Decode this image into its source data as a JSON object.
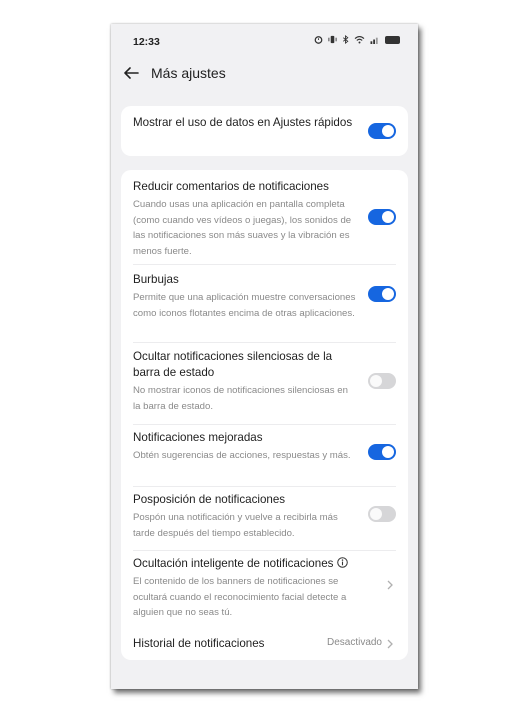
{
  "status_bar": {
    "time": "12:33",
    "icons": [
      "alarm-icon",
      "vibrate-icon",
      "bluetooth-icon",
      "wifi-icon",
      "signal-icon",
      "battery-icon"
    ]
  },
  "header": {
    "back_icon": "arrow-left-icon",
    "title": "Más ajustes"
  },
  "colors": {
    "accent": "#1666e0",
    "background": "#f1f1f3",
    "card": "#ffffff",
    "toggle_off": "#d6d6d8",
    "secondary_text": "#8a8a8a"
  },
  "settings": {
    "data_usage": {
      "title": "Mostrar el uso de datos en Ajustes rápidos",
      "enabled": true
    },
    "reduce_comments": {
      "title": "Reducir comentarios de notificaciones",
      "description": "Cuando usas una aplicación en pantalla completa (como cuando ves vídeos o juegas), los sonidos de las notificaciones son más suaves y la vibración es menos fuerte.",
      "enabled": true
    },
    "bubbles": {
      "title": "Burbujas",
      "description": "Permite que una aplicación muestre conversaciones como iconos flotantes encima de otras aplicaciones.",
      "enabled": true
    },
    "hide_silent": {
      "title": "Ocultar notificaciones silenciosas de la barra de estado",
      "description": "No mostrar iconos de notificaciones silenciosas en la barra de estado.",
      "enabled": false
    },
    "enhanced": {
      "title": "Notificaciones mejoradas",
      "description": "Obtén sugerencias de acciones, respuestas y más.",
      "enabled": true
    },
    "snooze": {
      "title": "Posposición de notificaciones",
      "description": "Pospón una notificación y vuelve a recibirla más tarde después del tiempo establecido.",
      "enabled": false
    },
    "smart_hide": {
      "title": "Ocultación inteligente de notificaciones",
      "description": "El contenido de los banners de notificaciones se ocultará cuando el reconocimiento facial detecte a alguien que no seas tú."
    },
    "history": {
      "title": "Historial de notificaciones",
      "value": "Desactivado"
    }
  }
}
